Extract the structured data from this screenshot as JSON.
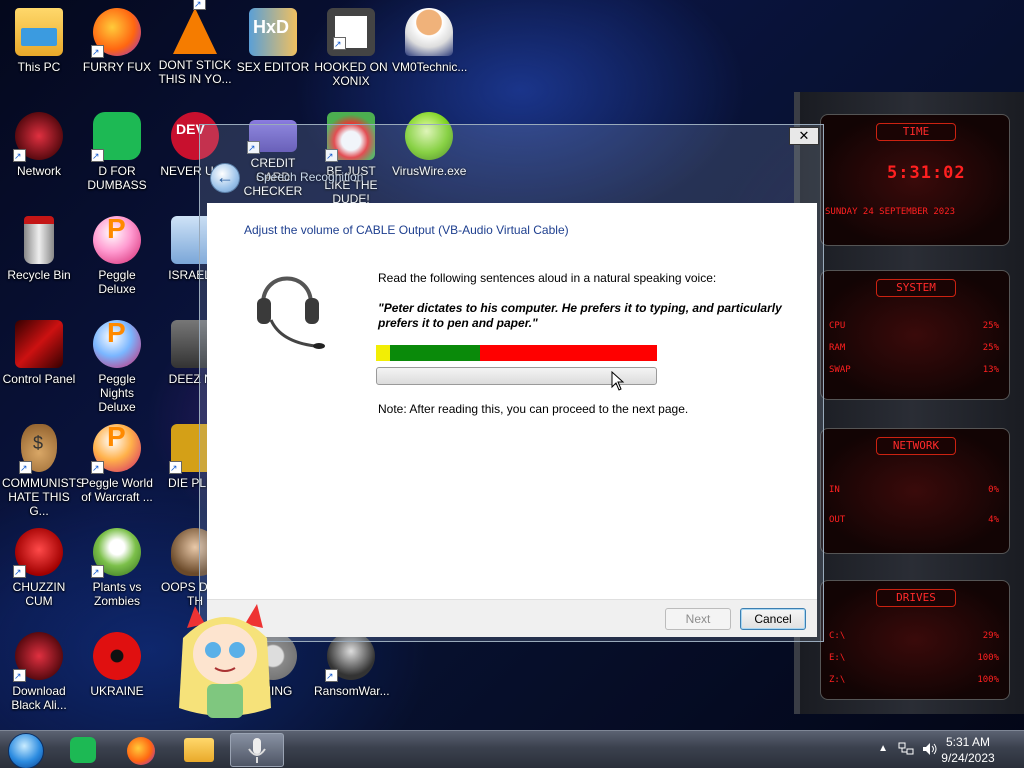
{
  "desktop": {
    "icons": [
      {
        "label": "This PC",
        "color": "#f6c24b"
      },
      {
        "label": "FURRY FUX",
        "color": "#ff7a1a"
      },
      {
        "label": "DONT STICK THIS IN YO...",
        "color": "#f57c00"
      },
      {
        "label": "SEX EDITOR",
        "color": "#c8a050"
      },
      {
        "label": "HOOKED ON XONIX",
        "color": "#444444"
      },
      {
        "label": "VM0Technic...",
        "color": "#e0a070"
      },
      {
        "label": "Network",
        "color": "#b2202a"
      },
      {
        "label": "D FOR DUMBASS",
        "color": "#1db954"
      },
      {
        "label": "NEVER USE",
        "color": "#c8102e"
      },
      {
        "label": "CREDIT CARD CHECKER",
        "color": "#6a5acd"
      },
      {
        "label": "BE JUST LIKE THE DUDE!",
        "color": "#4caf50"
      },
      {
        "label": "VirusWire.exe",
        "color": "#7ed321"
      },
      {
        "label": "Recycle Bin",
        "color": "#cc2222"
      },
      {
        "label": "Peggle Deluxe",
        "color": "#e04a8a"
      },
      {
        "label": "ISRAEL S",
        "color": "#7aa6d8"
      },
      {
        "label": "Control Panel",
        "color": "#cc1111"
      },
      {
        "label": "Peggle Nights Deluxe",
        "color": "#e04a8a"
      },
      {
        "label": "DEEZ NU",
        "color": "#555555"
      },
      {
        "label": "COMMUNISTS HATE THIS G...",
        "color": "#b5834a"
      },
      {
        "label": "Peggle World of Warcraft ...",
        "color": "#e04a8a"
      },
      {
        "label": "DIE PLEA",
        "color": "#d4a017"
      },
      {
        "label": "CHUZZIN CUM",
        "color": "#d62020"
      },
      {
        "label": "Plants vs Zombies",
        "color": "#6aa84f"
      },
      {
        "label": "OOPS D DO TH",
        "color": "#6b4a2a"
      },
      {
        "label": "Download Black Ali...",
        "color": "#b2202a"
      },
      {
        "label": "UKRAINE",
        "color": "#d01010"
      },
      {
        "label": "CHING",
        "color": "#888888"
      },
      {
        "label": "RansomWar...",
        "color": "#333333"
      }
    ]
  },
  "dialog": {
    "window_title": "Speech Recognition",
    "close_label": "✕",
    "back_label": "←",
    "heading": "Adjust the volume of CABLE Output (VB-Audio Virtual Cable)",
    "instruction": "Read the following sentences aloud in a natural speaking voice:",
    "quote": "\"Peter dictates to his computer. He prefers it to typing, and particularly prefers it to pen and paper.\"",
    "note": "Note: After reading this, you can proceed to the next page.",
    "next_label": "Next",
    "cancel_label": "Cancel",
    "meter_colors": {
      "low": "#f2ee05",
      "mid": "#0a8a0a",
      "high": "#ff0000"
    }
  },
  "widget": {
    "time_title": "TIME",
    "time": "5:31:02",
    "date": "SUNDAY 24 SEPTEMBER 2023",
    "system_title": "SYSTEM",
    "cpu_label": "CPU",
    "cpu_value": "25%",
    "ram_label": "RAM",
    "ram_value": "25%",
    "swap_label": "SWAP",
    "swap_value": "13%",
    "network_title": "NETWORK",
    "in_label": "IN",
    "in_value": "0%",
    "out_label": "OUT",
    "out_value": "4%",
    "drives_title": "DRIVES",
    "drives": [
      {
        "label": "C:\\",
        "value": "29%"
      },
      {
        "label": "E:\\",
        "value": "100%"
      },
      {
        "label": "Z:\\",
        "value": "100%"
      }
    ]
  },
  "taskbar": {
    "time": "5:31 AM",
    "date": "9/24/2023"
  }
}
